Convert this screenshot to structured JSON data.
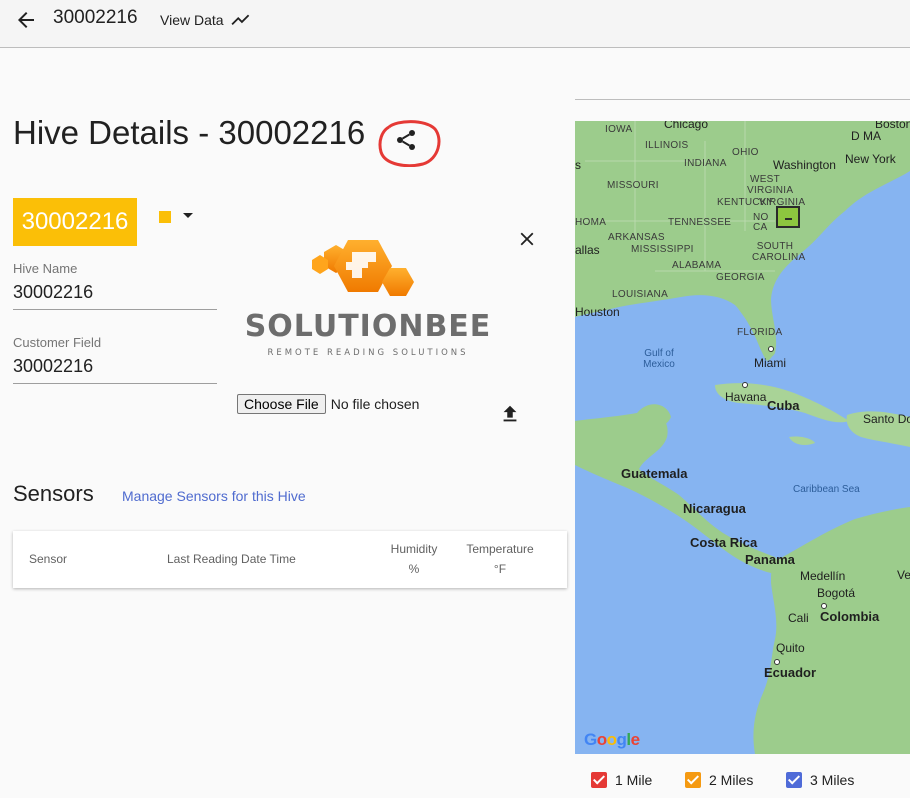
{
  "topbar": {
    "title": "30002216",
    "view_data_label": "View Data"
  },
  "page": {
    "title": "Hive Details - 30002216",
    "badge": "30002216",
    "badge_color": "#fbbf07",
    "accent_red": "#e53935"
  },
  "fields": {
    "hive_name_label": "Hive Name",
    "hive_name_value": "30002216",
    "customer_field_label": "Customer Field",
    "customer_field_value": "30002216"
  },
  "logo": {
    "name": "SOLUTIONBEE",
    "tagline": "REMOTE READING SOLUTIONS"
  },
  "file_upload": {
    "button_label": "Choose File",
    "status": "No file chosen"
  },
  "sensors": {
    "title": "Sensors",
    "manage_link": "Manage Sensors for this Hive",
    "columns": [
      {
        "line1": "Sensor",
        "line2": ""
      },
      {
        "line1": "Last Reading Date Time",
        "line2": ""
      },
      {
        "line1": "Humidity",
        "line2": "%"
      },
      {
        "line1": "Temperature",
        "line2": "°F"
      }
    ]
  },
  "map": {
    "states": [
      "IOWA",
      "ILLINOIS",
      "OHIO",
      "INDIANA",
      "MISSOURI",
      "WEST VIRGINIA",
      "KENTUCKY",
      "VIRGINIA",
      "TENNESSEE",
      "ARKANSAS",
      "MISSISSIPPI",
      "SOUTH CAROLINA",
      "ALABAMA",
      "GEORGIA",
      "LOUISIANA",
      "FLORIDA",
      "HOMA",
      "NO",
      "CA"
    ],
    "cities": [
      "Chicago",
      "Boston",
      "Washington",
      "New York",
      "Houston",
      "Miami",
      "Havana",
      "Santo Domingo",
      "Medellín",
      "Bogotá",
      "Cali",
      "Quito",
      "allas",
      "Ve",
      "s",
      "D MA"
    ],
    "countries": [
      "Cuba",
      "Guatemala",
      "Nicaragua",
      "Costa Rica",
      "Panama",
      "Colombia",
      "Ecuador"
    ],
    "seas": [
      "Gulf of Mexico",
      "Caribbean Sea"
    ],
    "attribution": "Google",
    "land_color": "#9ccc8c",
    "water_color": "#86b4f1",
    "marker_color": "#8dc63f"
  },
  "legend": [
    {
      "label": "1 Mile",
      "color": "#e53935"
    },
    {
      "label": "2 Miles",
      "color": "#f59a12"
    },
    {
      "label": "3 Miles",
      "color": "#4f6bd8"
    }
  ]
}
